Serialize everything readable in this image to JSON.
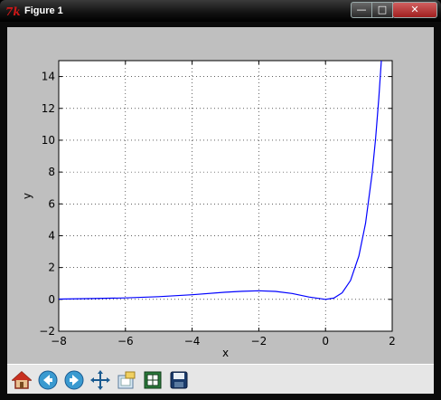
{
  "window": {
    "title": "Figure 1",
    "minimize_glyph": "—",
    "maximize_glyph": "□",
    "close_glyph": "✕"
  },
  "toolbar": {
    "buttons": [
      {
        "name": "home-icon",
        "label": "Home"
      },
      {
        "name": "back-icon",
        "label": "Back"
      },
      {
        "name": "forward-icon",
        "label": "Forward"
      },
      {
        "name": "pan-icon",
        "label": "Pan"
      },
      {
        "name": "zoom-icon",
        "label": "Zoom"
      },
      {
        "name": "subplots-icon",
        "label": "Configure subplots"
      },
      {
        "name": "save-icon",
        "label": "Save"
      }
    ]
  },
  "chart_data": {
    "type": "line",
    "title": "",
    "xlabel": "x",
    "ylabel": "y",
    "xlim": [
      -8,
      2
    ],
    "ylim": [
      -2,
      15
    ],
    "xticks": [
      -8,
      -6,
      -4,
      -2,
      0,
      2
    ],
    "yticks": [
      -2,
      0,
      2,
      4,
      6,
      8,
      10,
      12,
      14
    ],
    "xtick_labels": [
      "−8",
      "−6",
      "−4",
      "−2",
      "0",
      "2"
    ],
    "ytick_labels": [
      "−2",
      "0",
      "2",
      "4",
      "6",
      "8",
      "10",
      "12",
      "14"
    ],
    "grid": true,
    "series": [
      {
        "color": "#0000ff",
        "x": [
          -8,
          -7,
          -6,
          -5,
          -4,
          -3,
          -2.5,
          -2,
          -1.5,
          -1,
          -0.5,
          0,
          0.25,
          0.5,
          0.75,
          1,
          1.2,
          1.4,
          1.5,
          1.6,
          1.7
        ],
        "y": [
          0.02,
          0.05,
          0.09,
          0.17,
          0.29,
          0.45,
          0.51,
          0.54,
          0.5,
          0.37,
          0.15,
          0.0,
          0.08,
          0.41,
          1.19,
          2.72,
          4.78,
          7.96,
          10.08,
          12.66,
          15.78
        ]
      }
    ]
  }
}
